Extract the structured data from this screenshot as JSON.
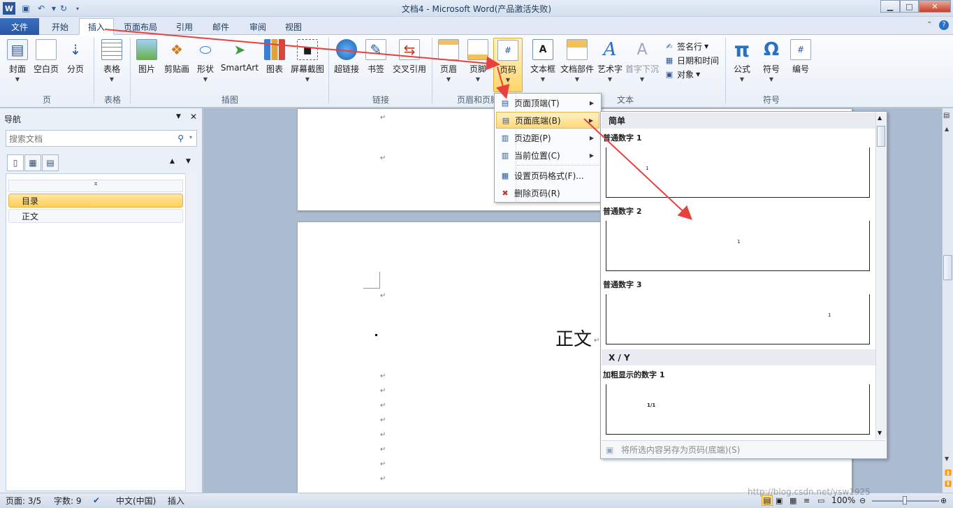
{
  "window": {
    "title": "文档4 - Microsoft Word(产品激活失败)",
    "min": "▁",
    "max": "□",
    "close": "✕"
  },
  "tabs": {
    "file": "文件",
    "items": [
      "开始",
      "插入",
      "页面布局",
      "引用",
      "邮件",
      "审阅",
      "视图"
    ],
    "active": "插入"
  },
  "ribbon": {
    "pages": {
      "cover": "封面",
      "blank": "空白页",
      "break": "分页",
      "group": "页"
    },
    "table": {
      "table": "表格",
      "group": "表格"
    },
    "illus": {
      "picture": "图片",
      "clipart": "剪贴画",
      "shape": "形状",
      "smartart": "SmartArt",
      "chart": "图表",
      "screenshot": "屏幕截图",
      "group": "插图"
    },
    "links": {
      "hyperlink": "超链接",
      "bookmark": "书签",
      "xref": "交叉引用",
      "group": "链接"
    },
    "hf": {
      "header": "页眉",
      "footer": "页脚",
      "pagenum": "页码",
      "group": "页眉和页脚"
    },
    "text": {
      "textbox": "文本框",
      "quickparts": "文档部件",
      "wordart": "艺术字",
      "dropcap": "首字下沉",
      "signature": "签名行",
      "datetime": "日期和时间",
      "object": "对象",
      "group": "文本"
    },
    "symbols": {
      "equation": "公式",
      "symbol": "符号",
      "number": "编号",
      "group": "符号"
    }
  },
  "nav": {
    "title": "导航",
    "search_placeholder": "搜索文档",
    "items": [
      "目录",
      "正文"
    ]
  },
  "doc": {
    "heading": "正文",
    "para_mark": "↵"
  },
  "menu1": {
    "items": [
      "页面顶端(T)",
      "页面底端(B)",
      "页边距(P)",
      "当前位置(C)",
      "设置页码格式(F)...",
      "删除页码(R)"
    ]
  },
  "menu2": {
    "sections": [
      "简单",
      "X / Y"
    ],
    "galleries": [
      "普通数字 1",
      "普通数字 2",
      "普通数字 3",
      "加粗显示的数字 1"
    ],
    "sample1": "1",
    "sample_xy": "1/1",
    "footer": "将所选内容另存为页码(底端)(S)"
  },
  "status": {
    "page": "页面: 3/5",
    "words": "字数: 9",
    "lang": "中文(中国)",
    "mode": "插入",
    "zoom": "100%"
  },
  "watermark": "http://blog.csdn.net/ysw1925",
  "colors": {
    "accent": "#2b579a",
    "highlight": "#ffd97a",
    "arrow": "#e8413d"
  }
}
